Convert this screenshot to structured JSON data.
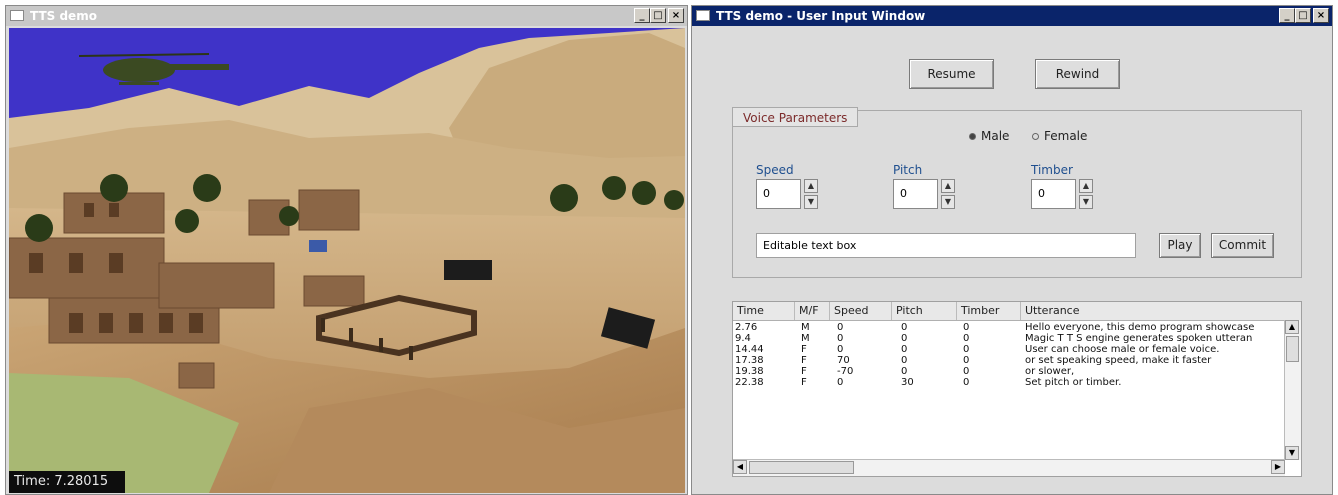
{
  "left_window": {
    "title": "TTS demo",
    "time_label": "Time: 7.28015"
  },
  "right_window": {
    "title": "TTS demo - User Input Window",
    "resume_label": "Resume",
    "rewind_label": "Rewind",
    "voice_group_title": "Voice Parameters",
    "gender": {
      "male": "Male",
      "female": "Female",
      "selected": "Male"
    },
    "speed": {
      "label": "Speed",
      "value": "0"
    },
    "pitch": {
      "label": "Pitch",
      "value": "0"
    },
    "timber": {
      "label": "Timber",
      "value": "0"
    },
    "text_input_value": "Editable text box",
    "play_label": "Play",
    "commit_label": "Commit",
    "table": {
      "headers": [
        "Time",
        "M/F",
        "Speed",
        "Pitch",
        "Timber",
        "Utterance"
      ],
      "rows": [
        [
          "2.76",
          "M",
          "0",
          "0",
          "0",
          "Hello everyone, this demo program showcase"
        ],
        [
          "9.4",
          "M",
          "0",
          "0",
          "0",
          "Magic T T S engine generates spoken utteran"
        ],
        [
          "14.44",
          "F",
          "0",
          "0",
          "0",
          "User can choose male or female voice."
        ],
        [
          "17.38",
          "F",
          "70",
          "0",
          "0",
          "or set speaking speed, make it faster"
        ],
        [
          "19.38",
          "F",
          "-70",
          "0",
          "0",
          "or slower,"
        ],
        [
          "22.38",
          "F",
          "0",
          "30",
          "0",
          "Set pitch or timber."
        ]
      ]
    }
  },
  "colors": {
    "active_titlebar": "#0a246a",
    "inactive_titlebar": "#c8c8c8",
    "sky": "#3f33c8",
    "sand": "#c8a576"
  }
}
